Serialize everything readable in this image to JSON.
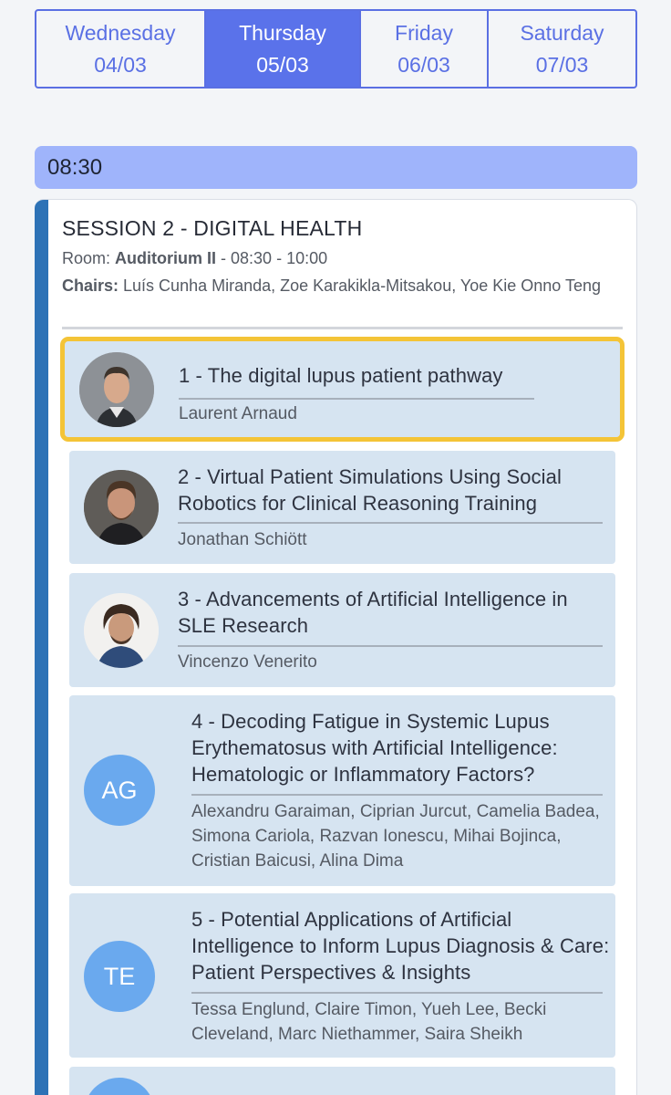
{
  "days": [
    {
      "name": "Wednesday",
      "date": "04/03"
    },
    {
      "name": "Thursday",
      "date": "05/03"
    },
    {
      "name": "Friday",
      "date": "06/03"
    },
    {
      "name": "Saturday",
      "date": "07/03"
    }
  ],
  "time_slot": "08:30",
  "session": {
    "title": "SESSION 2 - DIGITAL HEALTH",
    "room_label": "Room:",
    "room": "Auditorium II",
    "time_range": " - 08:30 - 10:00",
    "chairs_label": "Chairs:",
    "chairs": "Luís Cunha Miranda, Zoe Karakikla-Mitsakou, Yoe Kie Onno Teng"
  },
  "talks": [
    {
      "title": "1 - The digital lupus patient pathway",
      "speakers": "Laurent Arnaud"
    },
    {
      "title": "2 - Virtual Patient Simulations Using Social Robotics for Clinical Reasoning Training",
      "speakers": "Jonathan Schiött"
    },
    {
      "title": "3 - Advancements of Artificial Intelligence in SLE Research",
      "speakers": "Vincenzo Venerito"
    },
    {
      "title": "4 - Decoding Fatigue in Systemic Lupus Erythematosus with Artificial Intelligence: Hematologic or Inflammatory Factors?",
      "speakers": "Alexandru Garaiman, Ciprian Jurcut, Camelia Badea, Simona Cariola, Razvan Ionescu, Mihai Bojinca, Cristian Baicusi, Alina Dima",
      "initials": "AG"
    },
    {
      "title": "5 - Potential Applications of Artificial Intelligence to Inform Lupus Diagnosis & Care: Patient Perspectives & Insights",
      "speakers": "Tessa Englund, Claire Timon, Yueh Lee, Becki Cleveland, Marc Niethammer, Saira Sheikh",
      "initials": "TE"
    }
  ],
  "colors": {
    "accent": "#5a72ea",
    "time_bar": "#9fb4fb",
    "session_stripe": "#2d72b6",
    "talk_bg": "#d6e4f1",
    "highlight": "#f4c437",
    "initials_avatar": "#6aa9ee"
  }
}
